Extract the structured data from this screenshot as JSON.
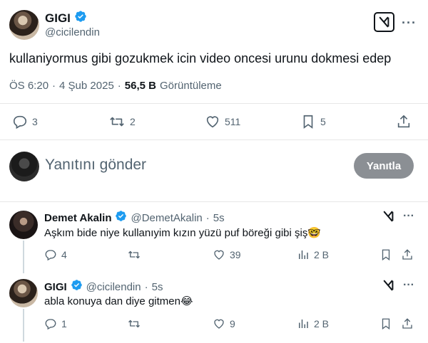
{
  "main_tweet": {
    "author_name": "GIGI",
    "author_handle": "@cicilendin",
    "text": "kullaniyormus gibi gozukmek icin video oncesi urunu dokmesi edep",
    "time": "ÖS 6:20",
    "date_sep": "·",
    "date": "4 Şub 2025",
    "views_sep": "·",
    "views_count": "56,5 B",
    "views_label": "Görüntüleme",
    "stats": {
      "replies": "3",
      "reposts": "2",
      "likes": "511",
      "bookmarks": "5"
    }
  },
  "composer": {
    "placeholder": "Yanıtını gönder",
    "reply_button": "Yanıtla"
  },
  "replies": [
    {
      "author_name": "Demet Akalin",
      "author_handle": "@DemetAkalin",
      "sep": "·",
      "age": "5s",
      "text": "Aşkım bide niye kullanıyim kızın yüzü puf böreği gibi şiş🤓",
      "stats": {
        "replies": "4",
        "reposts": "",
        "likes": "39",
        "views": "2 B"
      }
    },
    {
      "author_name": "GIGI",
      "author_handle": "@cicilendin",
      "sep": "·",
      "age": "5s",
      "text": "abla konuya dan diye gitmen😂",
      "stats": {
        "replies": "1",
        "reposts": "",
        "likes": "9",
        "views": "2 B"
      }
    }
  ],
  "colors": {
    "accent": "#1d9bf0",
    "muted": "#536471",
    "button_bg": "#8b8f94"
  }
}
